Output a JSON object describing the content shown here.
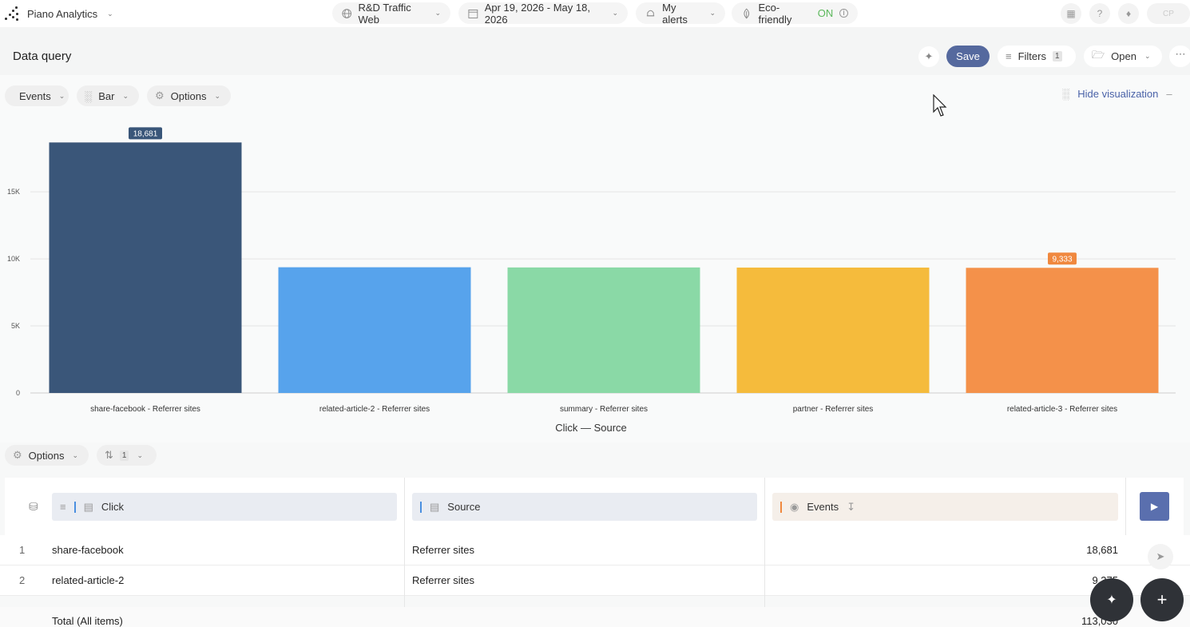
{
  "topbar": {
    "app_name": "Piano Analytics",
    "site": "R&D Traffic Web",
    "date_range": "Apr 19, 2026 - May 18, 2026",
    "alerts": "My alerts",
    "eco_label": "Eco-friendly",
    "eco_state": "ON",
    "avatar_initials": "CP"
  },
  "header": {
    "title": "Data query",
    "save": "Save",
    "filters": "Filters",
    "filters_count": "1",
    "open": "Open"
  },
  "viz_toolbar": {
    "metric": "Events",
    "chart_type": "Bar",
    "options": "Options",
    "hide_visualization": "Hide visualization"
  },
  "chart_data": {
    "type": "bar",
    "categories": [
      "share-facebook - Referrer sites",
      "related-article-2 - Referrer sites",
      "summary - Referrer sites",
      "partner - Referrer sites",
      "related-article-3 - Referrer sites"
    ],
    "values": [
      18681,
      9375,
      9360,
      9350,
      9333
    ],
    "colors": [
      "#3a5679",
      "#57a3ec",
      "#8ad9a6",
      "#f5bb3c",
      "#f4914a"
    ],
    "data_labels": [
      {
        "index": 0,
        "text": "18,681",
        "color": "#3a5679"
      },
      {
        "index": 4,
        "text": "9,333",
        "color": "#f0883e"
      }
    ],
    "yticks": [
      "0",
      "5K",
      "10K",
      "15K"
    ],
    "ylim": [
      0,
      20000
    ],
    "xlabel": "Click — Source",
    "grid": true
  },
  "table_toolbar": {
    "options": "Options",
    "sort_count": "1"
  },
  "table": {
    "columns": [
      "Click",
      "Source",
      "Events"
    ],
    "rows": [
      {
        "index": "1",
        "click": "share-facebook",
        "source": "Referrer sites",
        "events": "18,681"
      },
      {
        "index": "2",
        "click": "related-article-2",
        "source": "Referrer sites",
        "events": "9,375"
      }
    ],
    "total_label": "Total (All items)",
    "total_value": "113,030"
  }
}
